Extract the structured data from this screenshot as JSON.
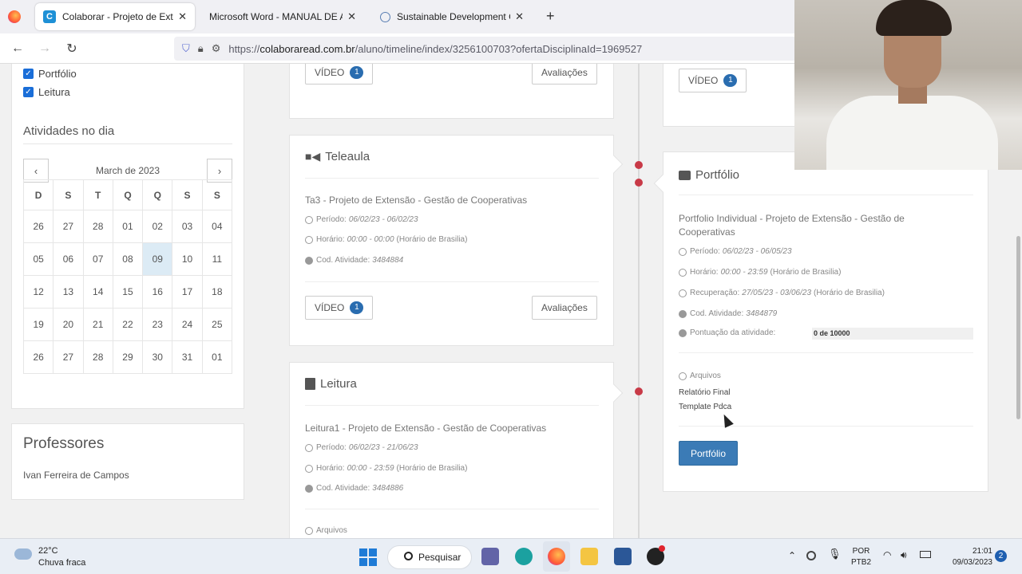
{
  "browser": {
    "tabs": [
      {
        "label": "Colaborar - Projeto de Extensão",
        "active": true
      },
      {
        "label": "Microsoft Word - MANUAL DE ATIVI",
        "active": false
      },
      {
        "label": "Sustainable Development Goal",
        "active": false
      }
    ],
    "new_tab": "+",
    "url_prefix": "https://",
    "url_host": "colaboraread.com.br",
    "url_path": "/aluno/timeline/index/3256100703?ofertaDisciplinaId=1969527"
  },
  "sidebar": {
    "filters": [
      {
        "label": "Portfólio",
        "checked": true
      },
      {
        "label": "Leitura",
        "checked": true
      }
    ],
    "activities_title": "Atividades no dia",
    "calendar": {
      "month": "March de 2023",
      "weekdays": [
        "D",
        "S",
        "T",
        "Q",
        "Q",
        "S",
        "S"
      ],
      "weeks": [
        [
          "26",
          "27",
          "28",
          "01",
          "02",
          "03",
          "04"
        ],
        [
          "05",
          "06",
          "07",
          "08",
          "09",
          "10",
          "11"
        ],
        [
          "12",
          "13",
          "14",
          "15",
          "16",
          "17",
          "18"
        ],
        [
          "19",
          "20",
          "21",
          "22",
          "23",
          "24",
          "25"
        ],
        [
          "26",
          "27",
          "28",
          "29",
          "30",
          "31",
          "01"
        ]
      ],
      "today": "09"
    },
    "professors_title": "Professores",
    "professor": "Ivan Ferreira de Campos"
  },
  "cards": {
    "top_left": {
      "video_label": "VÍDEO",
      "video_count": "1",
      "evaluations": "Avaliações"
    },
    "top_right": {
      "video_label": "VÍDEO",
      "video_count": "1"
    },
    "teleaula": {
      "title": "Teleaula",
      "subtitle": "Ta3 - Projeto de Extensão - Gestão de Cooperativas",
      "periodo_label": "Período:",
      "periodo": "06/02/23 - 06/02/23",
      "horario_label": "Horário:",
      "horario": "00:00 - 00:00",
      "horario_tz": "(Horário de Brasilia)",
      "cod_label": "Cod. Atividade:",
      "cod": "3484884",
      "video_label": "VÍDEO",
      "video_count": "1",
      "evaluations": "Avaliações"
    },
    "leitura": {
      "title": "Leitura",
      "subtitle": "Leitura1 - Projeto de Extensão - Gestão de Cooperativas",
      "periodo_label": "Período:",
      "periodo": "06/02/23 - 21/06/23",
      "horario_label": "Horário:",
      "horario": "00:00 - 23:59",
      "horario_tz": "(Horário de Brasilia)",
      "cod_label": "Cod. Atividade:",
      "cod": "3484886",
      "files_label": "Arquivos"
    },
    "portfolio": {
      "title": "Portfólio",
      "subtitle": "Portfolio Individual - Projeto de Extensão - Gestão de Cooperativas",
      "periodo_label": "Período:",
      "periodo": "06/02/23 - 06/05/23",
      "horario_label": "Horário:",
      "horario": "00:00 - 23:59",
      "horario_tz": "(Horário de Brasilia)",
      "recuperacao_label": "Recuperação:",
      "recuperacao": "27/05/23 - 03/06/23",
      "recuperacao_tz": "(Horário de Brasilia)",
      "cod_label": "Cod. Atividade:",
      "cod": "3484879",
      "score_label": "Pontuação da atividade:",
      "score": "0 de 10000",
      "files_label": "Arquivos",
      "files": [
        "Relatório Final",
        "Template Pdca"
      ],
      "button": "Portfólio"
    }
  },
  "taskbar": {
    "weather_temp": "22°C",
    "weather_desc": "Chuva fraca",
    "search": "Pesquisar",
    "lang1": "POR",
    "lang2": "PTB2",
    "time": "21:01",
    "date": "09/03/2023",
    "notif": "2"
  },
  "colors": {
    "accent": "#2a6db0",
    "timeline_dot": "#c83a47",
    "today_bg": "#dcebf5"
  }
}
